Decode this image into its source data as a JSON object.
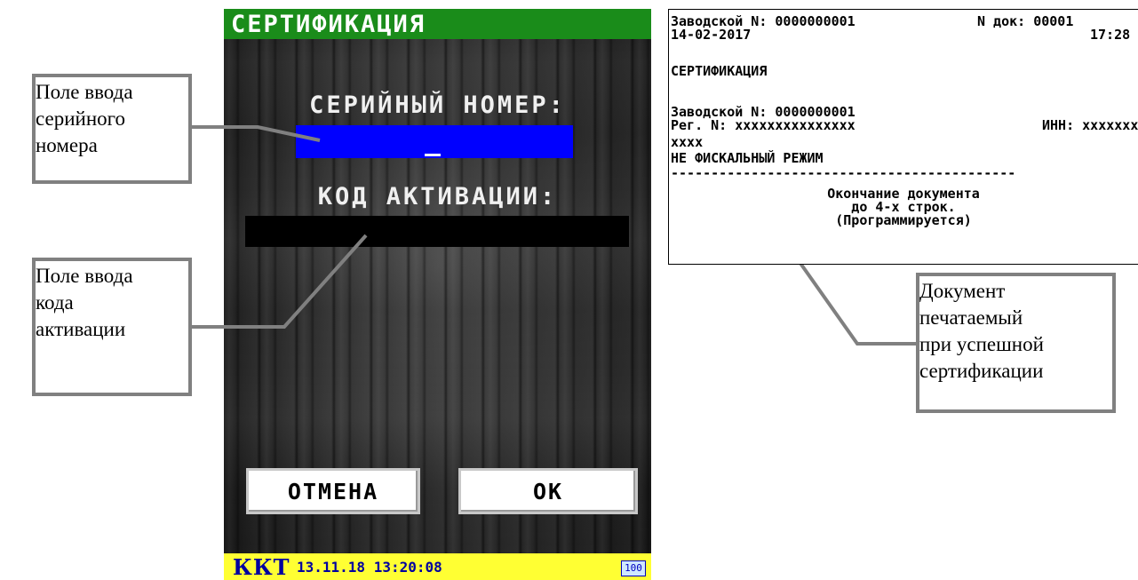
{
  "device": {
    "title": "СЕРТИФИКАЦИЯ",
    "serial_label": "СЕРИЙНЫЙ НОМЕР:",
    "serial_value": "_",
    "activation_label": "КОД АКТИВАЦИИ:",
    "activation_value": "",
    "cancel_label": "ОТМЕНА",
    "ok_label": "ОК",
    "status": {
      "device_name": "ККТ",
      "datetime": "13.11.18 13:20:08",
      "battery": "100"
    },
    "colors": {
      "title_bar": "#1a8c1a",
      "serial_field": "#0000ff",
      "status_bar": "#ffff33",
      "status_text": "#0000a0"
    }
  },
  "callouts": {
    "serial": [
      "Поле ввода",
      "серийного",
      "номера"
    ],
    "activation": [
      "Поле ввода",
      "кода",
      "активации"
    ],
    "document": [
      "Документ",
      "печатаемый",
      "при успешной",
      "сертификации"
    ]
  },
  "receipt": {
    "factory_no_top": "Заводской N: 0000000001",
    "doc_no": "N док: 00001",
    "date": "14-02-2017",
    "time": "17:28",
    "title": "СЕРТИФИКАЦИЯ",
    "factory_no": "Заводской N: 0000000001",
    "reg_no": "Рег. N: xxxxxxxxxxxxxxx",
    "inn": "ИНН: xxxxxxxx",
    "inn_cont": "xxxx",
    "mode": "НЕ ФИСКАЛЬНЫЙ РЕЖИМ",
    "separator": "-------------------------------------------",
    "footer": [
      "Окончание документа",
      "до 4-х строк.",
      "(Программируется)"
    ]
  }
}
